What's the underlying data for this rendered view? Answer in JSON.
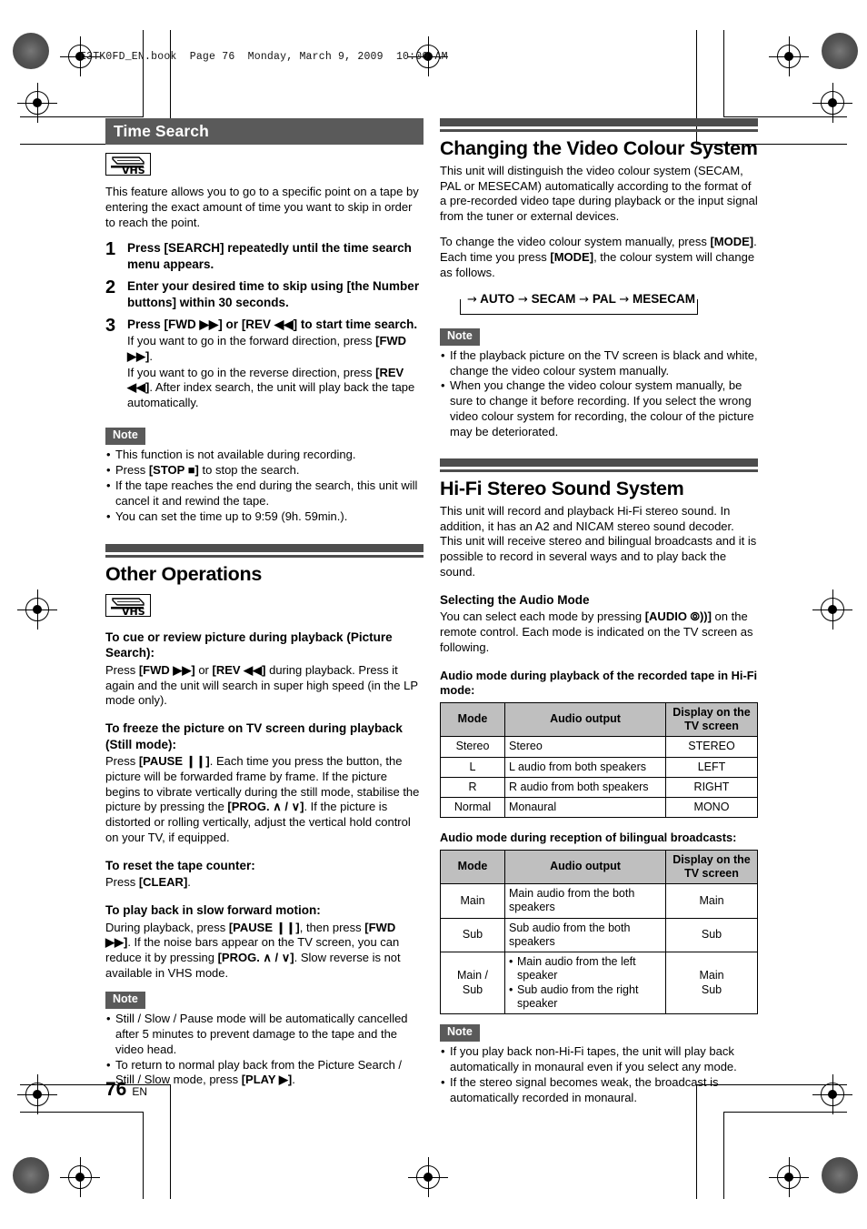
{
  "file_header": "E3TK0FD_EN.book  Page 76  Monday, March 9, 2009  10:00 AM",
  "footer": {
    "page_number": "76",
    "lang": "EN"
  },
  "colors": {
    "bar": "#4d4d4d",
    "badge": "#5a5a5a",
    "table_header": "#bfbfbf"
  },
  "left_column": {
    "time_search": {
      "heading": "Time Search",
      "media_icon": "vhs-icon",
      "intro": "This feature allows you to go to a specific point on a tape by entering the exact amount of time you want to skip in order to reach the point.",
      "steps": [
        {
          "num": "1",
          "title": "Press [SEARCH] repeatedly until the time search menu appears.",
          "detail": ""
        },
        {
          "num": "2",
          "title": "Enter your desired time to skip using [the Number buttons] within 30 seconds.",
          "detail": ""
        },
        {
          "num": "3",
          "title": "Press [FWD ▶▶] or [REV ◀◀] to start time search.",
          "detail": ""
        }
      ],
      "step3_detail": [
        "If you want to go in the forward direction, press [FWD ▶▶].",
        "If you want to go in the reverse direction, press [REV ◀◀]. After index search, the unit will play back the tape automatically."
      ],
      "note_label": "Note",
      "notes": [
        "This function is not available during recording.",
        "Press [STOP ■] to stop the search.",
        "If the tape reaches the end during the search, this unit will cancel it and rewind the tape.",
        "You can set the time up to 9:59 (9h. 59min.)."
      ]
    },
    "other_operations": {
      "heading": "Other Operations",
      "media_icon": "vhs-icon",
      "sections": [
        {
          "title": "To cue or review picture during playback (Picture Search):",
          "body": "Press [FWD ▶▶] or [REV ◀◀] during playback. Press it again and the unit will search in super high speed (in the LP mode only)."
        },
        {
          "title": "To freeze the picture on TV screen during playback (Still mode):",
          "body": "Press [PAUSE ❙❙]. Each time you press the button, the picture will be forwarded frame by frame. If the picture begins to vibrate vertically during the still mode, stabilise the picture by pressing the [PROG. ∧ / ∨]. If the picture is distorted or rolling vertically, adjust the vertical hold control on your TV, if equipped."
        },
        {
          "title": "To reset the tape counter:",
          "body": "Press [CLEAR]."
        },
        {
          "title": "To play back in slow forward motion:",
          "body": "During playback, press [PAUSE ❙❙], then press [FWD ▶▶]. If the noise bars appear on the TV screen, you can reduce it by pressing [PROG. ∧ / ∨]. Slow reverse is not available in VHS mode."
        }
      ],
      "note_label": "Note",
      "notes": [
        "Still / Slow / Pause mode will be automatically cancelled after 5 minutes to prevent damage to the tape and the video head.",
        "To return to normal play back from the Picture Search / Still / Slow mode, press [PLAY ▶]."
      ]
    }
  },
  "right_column": {
    "video_colour": {
      "heading": "Changing the Video Colour System",
      "para1": "This unit will distinguish the video colour system (SECAM, PAL or MESECAM) automatically according to the format of a pre-recorded video tape during playback or the input signal from the tuner or external devices.",
      "para2": "To change the video colour system manually, press [MODE]. Each time you press [MODE], the colour system will change as follows.",
      "cycle": [
        "AUTO",
        "SECAM",
        "PAL",
        "MESECAM"
      ],
      "cycle_arrow": "→",
      "note_label": "Note",
      "notes": [
        "If the playback picture on the TV screen is black and white, change the video colour system manually.",
        "When you change the video colour system manually, be sure to change it before recording. If you select the wrong video colour system for recording, the colour of the picture may be deteriorated."
      ]
    },
    "hifi": {
      "heading": "Hi-Fi Stereo Sound System",
      "intro": "This unit will record and playback Hi-Fi stereo sound. In addition, it has an A2 and NICAM stereo sound decoder. This unit will receive stereo and bilingual broadcasts and it is possible to record in several ways and to play back the sound.",
      "sub_heading": "Selecting the Audio Mode",
      "sub_body": "You can select each mode by pressing [AUDIO ⦾))] on the remote control. Each mode is indicated on the TV screen as following.",
      "table1": {
        "caption": "Audio mode during playback of the recorded tape in Hi-Fi mode:",
        "columns": [
          "Mode",
          "Audio output",
          "Display on the TV screen"
        ],
        "rows": [
          [
            "Stereo",
            "Stereo",
            "STEREO"
          ],
          [
            "L",
            "L audio from both speakers",
            "LEFT"
          ],
          [
            "R",
            "R audio from both speakers",
            "RIGHT"
          ],
          [
            "Normal",
            "Monaural",
            "MONO"
          ]
        ]
      },
      "table2": {
        "caption": "Audio mode during reception of bilingual broadcasts:",
        "columns": [
          "Mode",
          "Audio output",
          "Display on the TV screen"
        ],
        "rows": [
          {
            "mode": "Main",
            "output": [
              "Main audio from the both speakers"
            ],
            "display": [
              "Main"
            ],
            "bulleted": false
          },
          {
            "mode": "Sub",
            "output": [
              "Sub audio from the both speakers"
            ],
            "display": [
              "Sub"
            ],
            "bulleted": false
          },
          {
            "mode": "Main /\nSub",
            "output": [
              "Main audio from the left speaker",
              "Sub audio from the right speaker"
            ],
            "display": [
              "Main",
              "Sub"
            ],
            "bulleted": true
          }
        ]
      },
      "note_label": "Note",
      "notes": [
        "If you play back non-Hi-Fi tapes, the unit will play back automatically in monaural even if you select any mode.",
        "If the stereo signal becomes weak, the broadcast is automatically recorded in monaural."
      ]
    }
  }
}
